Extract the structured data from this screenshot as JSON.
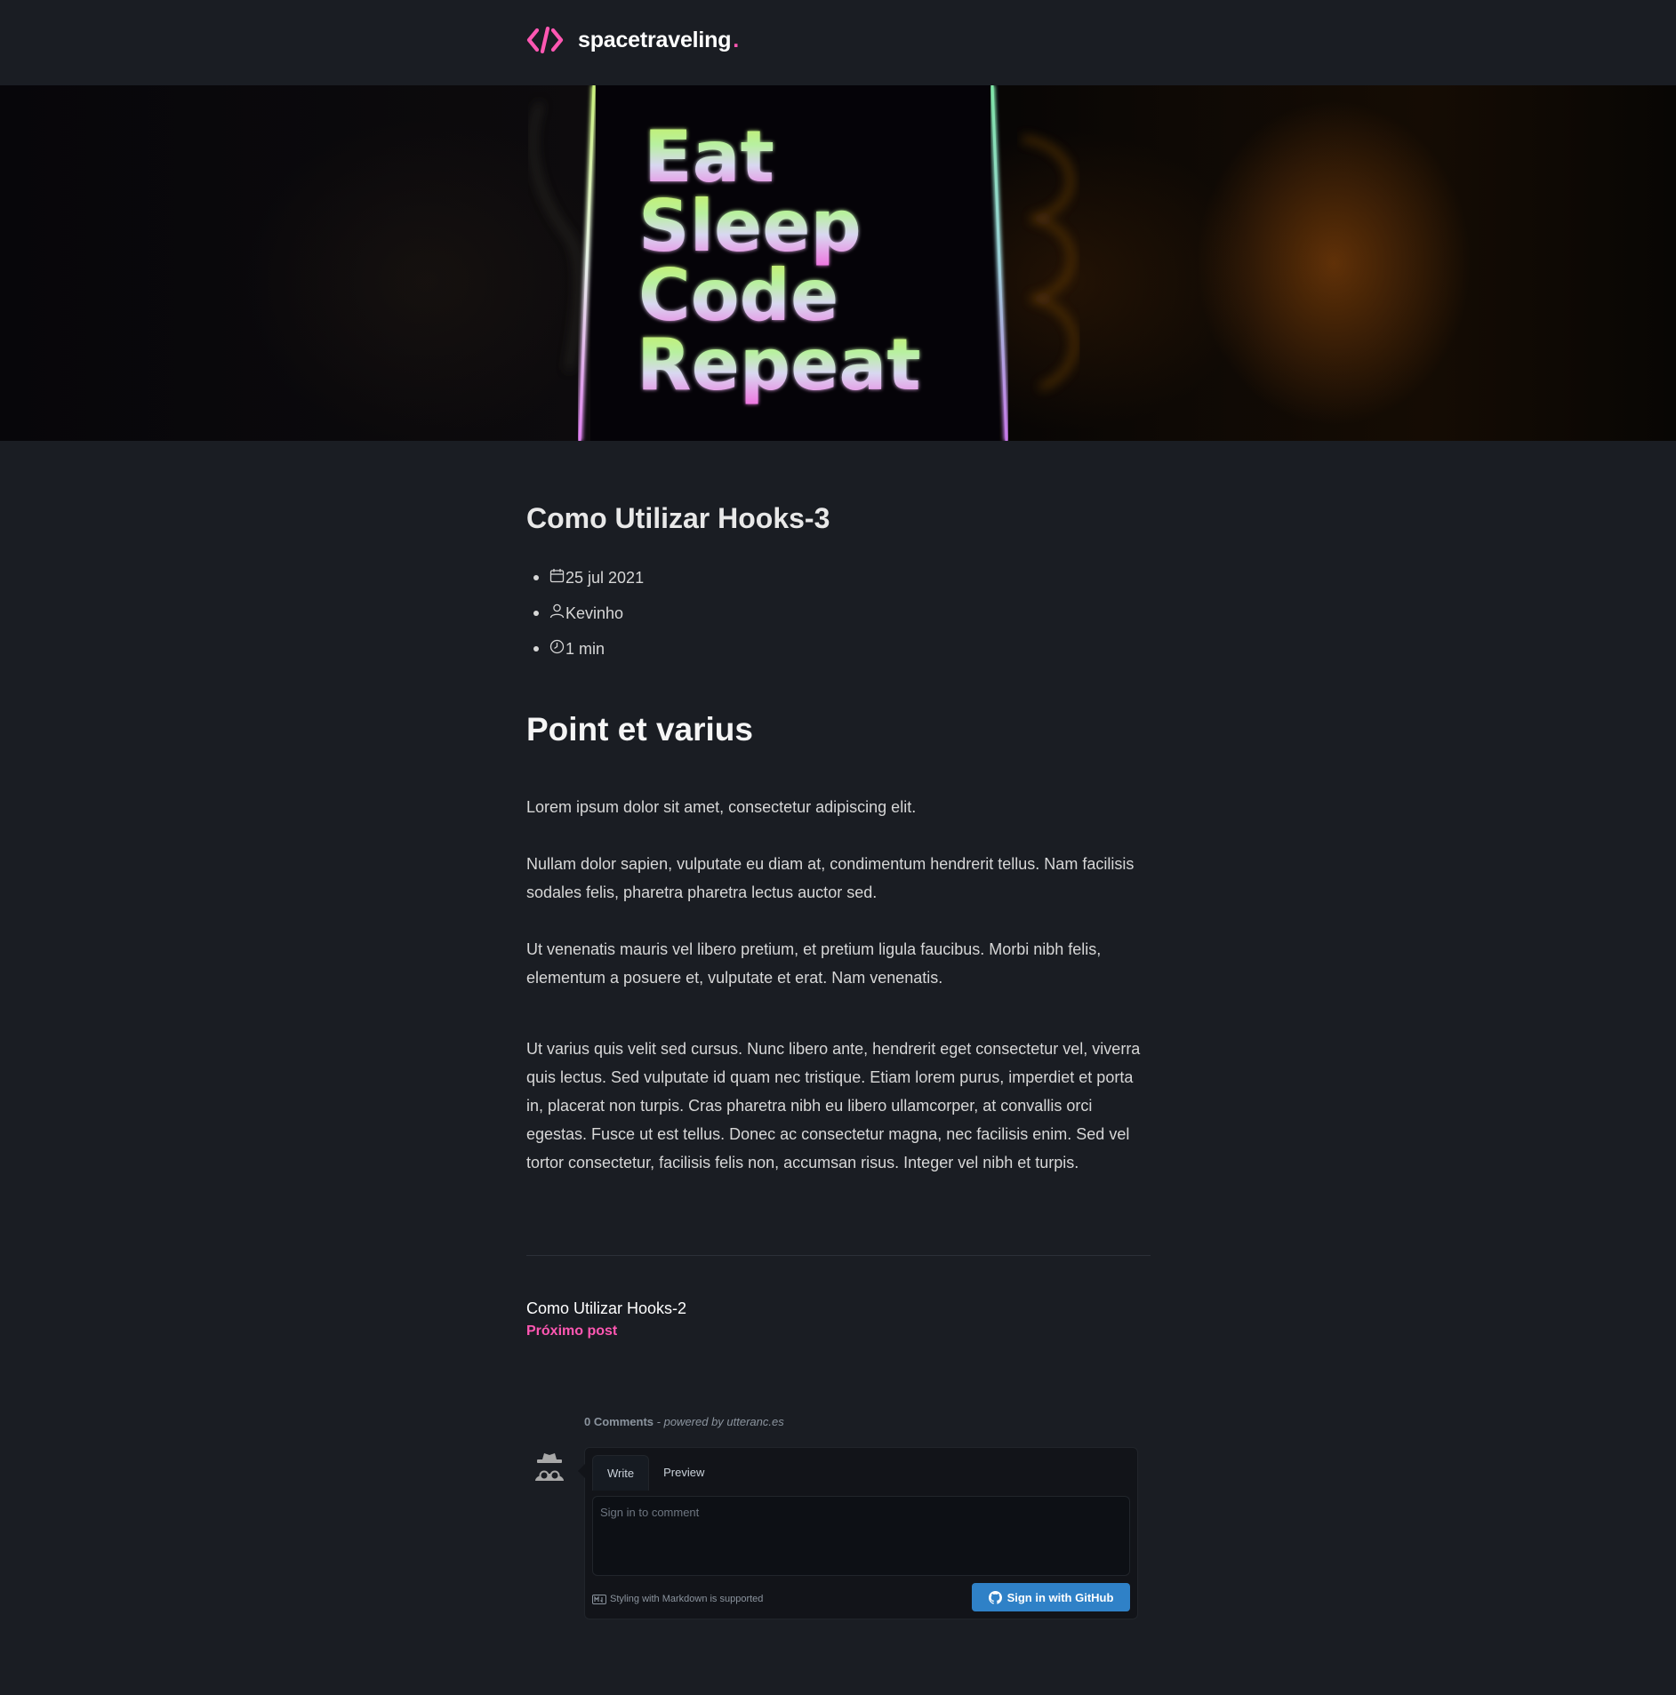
{
  "header": {
    "brand": "spacetraveling",
    "brand_dot": ".",
    "logo_icon": "code-brackets-icon",
    "accent_color": "#ff57b2"
  },
  "banner": {
    "image_text": [
      "Eat",
      "Sleep",
      "Code",
      "Repeat"
    ]
  },
  "post": {
    "title": "Como Utilizar Hooks-3",
    "meta": {
      "date": "25 jul 2021",
      "author": "Kevinho",
      "reading_time": "1 min"
    },
    "heading": "Point et varius",
    "paragraphs": [
      "Lorem ipsum dolor sit amet, consectetur adipiscing elit.",
      "Nullam dolor sapien, vulputate eu diam at, condimentum hendrerit tellus. Nam facilisis sodales felis, pharetra pharetra lectus auctor sed.",
      "Ut venenatis mauris vel libero pretium, et pretium ligula faucibus. Morbi nibh felis, elementum a posuere et, vulputate et erat. Nam venenatis.",
      "Ut varius quis velit sed cursus. Nunc libero ante, hendrerit eget consectetur vel, viverra quis lectus. Sed vulputate id quam nec tristique. Etiam lorem purus, imperdiet et porta in, placerat non turpis. Cras pharetra nibh eu libero ullamcorper, at convallis orci egestas. Fusce ut est tellus. Donec ac consectetur magna, nec facilisis enim. Sed vel tortor consectetur, facilisis felis non, accumsan risus. Integer vel nibh et turpis."
    ]
  },
  "navigation": {
    "next_title": "Como Utilizar Hooks-2",
    "next_label": "Próximo post"
  },
  "comments": {
    "count": "0 Comments",
    "powered_by": "- powered by utteranc.es",
    "tabs": [
      "Write",
      "Preview"
    ],
    "placeholder": "Sign in to comment",
    "markdown_note": "Styling with Markdown is supported",
    "signin_label": "Sign in with GitHub",
    "button_color": "#2f81c7"
  }
}
